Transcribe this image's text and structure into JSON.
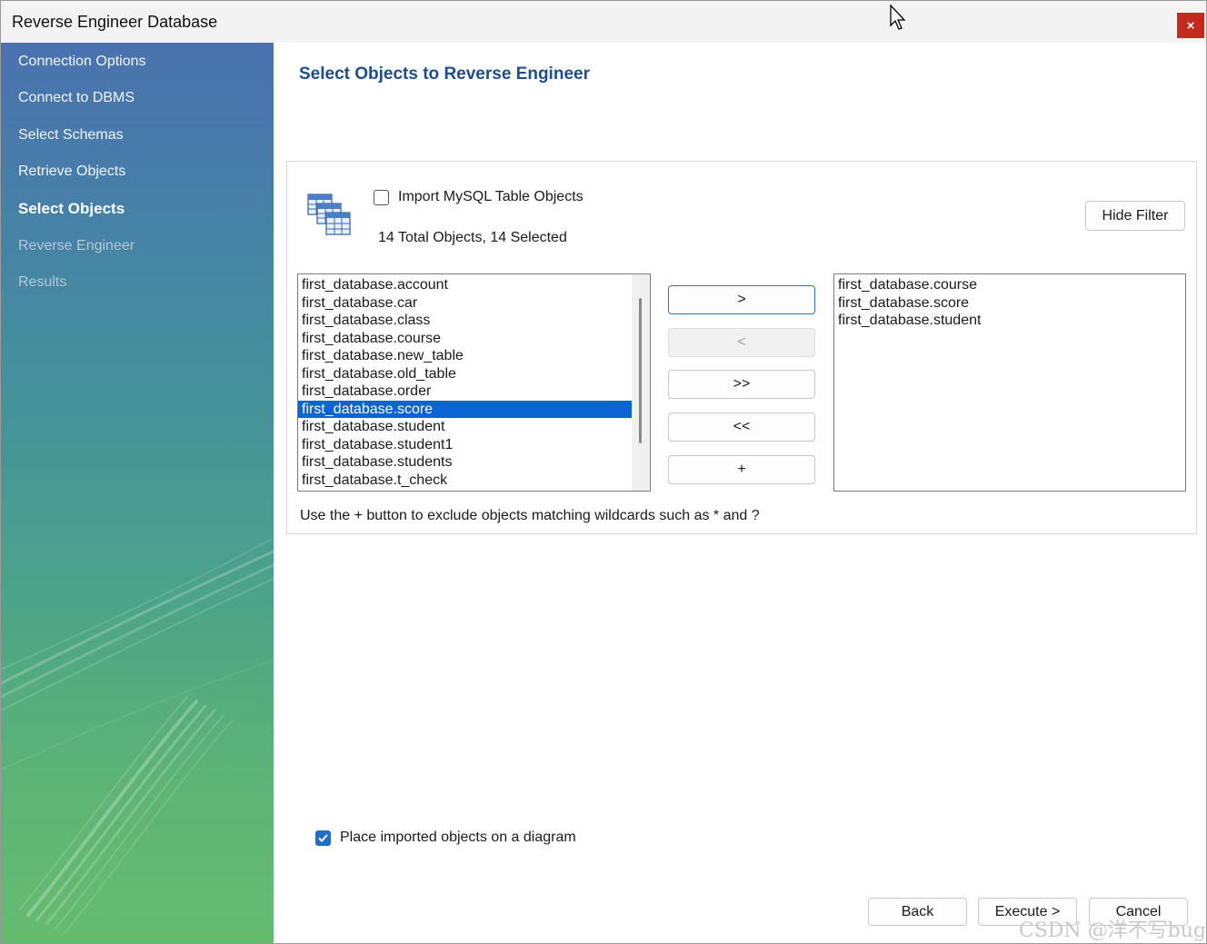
{
  "window": {
    "title": "Reverse Engineer Database",
    "close_label": "×"
  },
  "sidebar": {
    "items": [
      {
        "label": "Connection Options",
        "state": "done"
      },
      {
        "label": "Connect to DBMS",
        "state": "done"
      },
      {
        "label": "Select Schemas",
        "state": "done"
      },
      {
        "label": "Retrieve Objects",
        "state": "done"
      },
      {
        "label": "Select Objects",
        "state": "active"
      },
      {
        "label": "Reverse Engineer",
        "state": "pending"
      },
      {
        "label": "Results",
        "state": "pending"
      }
    ]
  },
  "main": {
    "title": "Select Objects to Reverse Engineer",
    "import_checkbox": {
      "label": "Import MySQL Table Objects",
      "checked": false
    },
    "count_text": "14 Total Objects, 14 Selected",
    "hide_filter_label": "Hide Filter",
    "available_list": [
      "first_database.account",
      "first_database.car",
      "first_database.class",
      "first_database.course",
      "first_database.new_table",
      "first_database.old_table",
      "first_database.order",
      "first_database.score",
      "first_database.student",
      "first_database.student1",
      "first_database.students",
      "first_database.t_check"
    ],
    "available_selected": "first_database.score",
    "excluded_list": [
      "first_database.course",
      "first_database.score",
      "first_database.student"
    ],
    "transfer_buttons": {
      "move_right": ">",
      "move_left": "<",
      "move_all_right": ">>",
      "move_all_left": "<<",
      "add_wildcard": "+"
    },
    "hint": "Use the + button to exclude objects matching wildcards such as * and ?",
    "place_on_diagram": {
      "label": "Place imported objects on a diagram",
      "checked": true
    }
  },
  "footer": {
    "back_label": "Back",
    "execute_label": "Execute >",
    "cancel_label": "Cancel"
  },
  "watermark": "CSDN @洋不写bug",
  "colors": {
    "title_blue": "#1e4d8f",
    "selection_blue": "#0a64d2",
    "close_red": "#c42b1c"
  }
}
